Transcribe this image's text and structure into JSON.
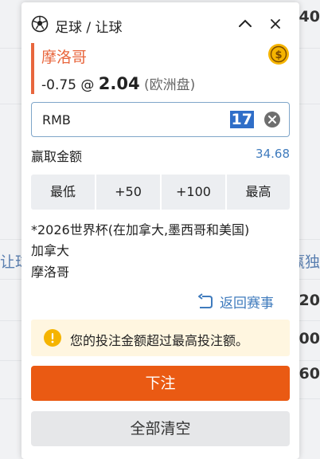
{
  "background": {
    "left_text": "让球",
    "right_text": "赢独",
    "top_odds": ".40",
    "odds": [
      ".20",
      ".00",
      ".60"
    ]
  },
  "header": {
    "title": "足球 / 让球"
  },
  "selection": {
    "team": "摩洛哥",
    "handicap": "-0.75 @ ",
    "price": "2.04",
    "odds_type": " (欧洲盘)"
  },
  "stake": {
    "currency": "RMB",
    "value": "17"
  },
  "winnings": {
    "label": "赢取金额",
    "value": "34.68"
  },
  "quick_stakes": [
    "最低",
    "+50",
    "+100",
    "最高"
  ],
  "event": {
    "competition": "*2026世界杯(在加拿大,墨西哥和美国)",
    "home": "加拿大",
    "away": "摩洛哥"
  },
  "back_label": "返回赛事",
  "warning": "您的投注金额超过最高投注额。",
  "buttons": {
    "place_bet": "下注",
    "clear_all": "全部清空"
  },
  "colors": {
    "accent": "#ea5a13",
    "team": "#e8663d",
    "link": "#3f7bbd",
    "warning_bg": "#fff6e0",
    "warning_icon": "#f5b400"
  },
  "icons": [
    "soccer-ball-icon",
    "chevron-up-icon",
    "close-icon",
    "cash-out-coin-icon",
    "clear-input-icon",
    "return-arrow-icon",
    "warning-icon"
  ]
}
